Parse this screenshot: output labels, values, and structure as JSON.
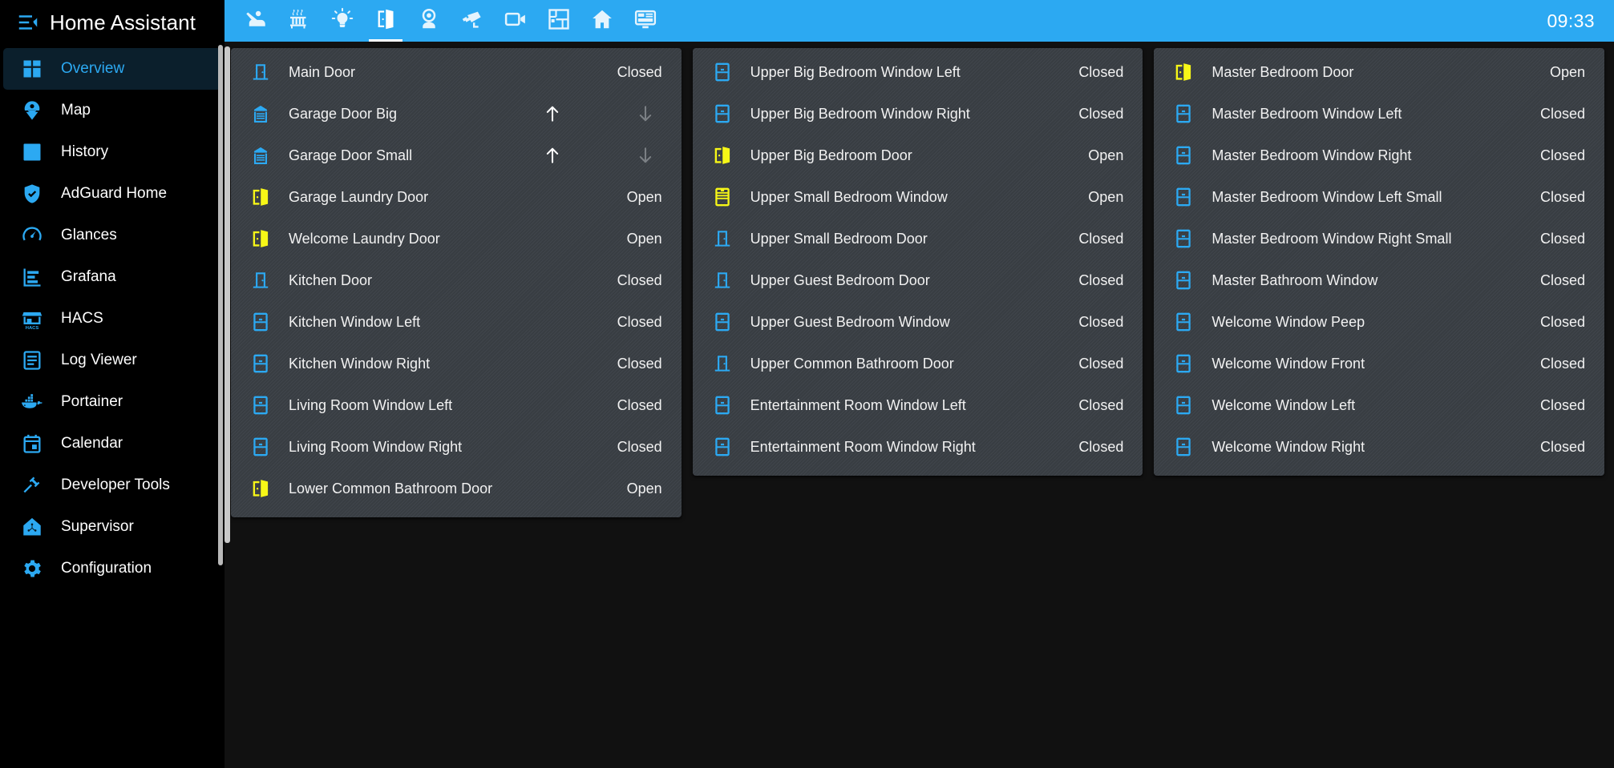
{
  "app": {
    "title": "Home Assistant",
    "accent_color": "#2ca9f2",
    "open_color": "#f7f717",
    "closed_color": "#2ca9f2",
    "menu_icon": "menu-collapse-icon"
  },
  "sidebar": {
    "items": [
      {
        "label": "Overview",
        "icon": "view-dashboard-icon",
        "active": true
      },
      {
        "label": "Map",
        "icon": "map-marker-account-icon",
        "active": false
      },
      {
        "label": "History",
        "icon": "chart-box-icon",
        "active": false
      },
      {
        "label": "AdGuard Home",
        "icon": "shield-check-icon",
        "active": false
      },
      {
        "label": "Glances",
        "icon": "gauge-icon",
        "active": false
      },
      {
        "label": "Grafana",
        "icon": "chart-bar-stacked-icon",
        "active": false
      },
      {
        "label": "HACS",
        "icon": "hacs-store-icon",
        "active": false
      },
      {
        "label": "Log Viewer",
        "icon": "file-document-icon",
        "active": false
      },
      {
        "label": "Portainer",
        "icon": "docker-whale-icon",
        "active": false
      },
      {
        "label": "Calendar",
        "icon": "calendar-icon",
        "active": false
      },
      {
        "label": "Developer Tools",
        "icon": "hammer-icon",
        "active": false
      },
      {
        "label": "Supervisor",
        "icon": "home-assistant-supervisor-icon",
        "active": false
      },
      {
        "label": "Configuration",
        "icon": "cog-icon",
        "active": false
      }
    ]
  },
  "topbar": {
    "clock": "09:33",
    "tabs": [
      {
        "icon": "person-lounging-icon",
        "name": "lounge",
        "active": false
      },
      {
        "icon": "radiator-icon",
        "name": "heating",
        "active": false
      },
      {
        "icon": "lightbulb-icon",
        "name": "lights",
        "active": false
      },
      {
        "icon": "door-open-icon",
        "name": "doors",
        "active": true
      },
      {
        "icon": "webcam-icon",
        "name": "webcam",
        "active": false
      },
      {
        "icon": "cctv-icon",
        "name": "cctv",
        "active": false
      },
      {
        "icon": "video-icon",
        "name": "video",
        "active": false
      },
      {
        "icon": "floor-plan-icon",
        "name": "floorplan",
        "active": false
      },
      {
        "icon": "home-icon",
        "name": "home",
        "active": false
      },
      {
        "icon": "monitor-dashboard-icon",
        "name": "dashboard",
        "active": false
      }
    ]
  },
  "columns": [
    {
      "rows": [
        {
          "icon": "door-closed-icon",
          "name": "Main Door",
          "state": "Closed",
          "type": "state"
        },
        {
          "icon": "garage-icon",
          "name": "Garage Door Big",
          "state": "",
          "type": "cover",
          "up_enabled": true,
          "down_enabled": false
        },
        {
          "icon": "garage-icon",
          "name": "Garage Door Small",
          "state": "",
          "type": "cover",
          "up_enabled": true,
          "down_enabled": false
        },
        {
          "icon": "door-open-icon",
          "name": "Garage Laundry Door",
          "state": "Open",
          "type": "state"
        },
        {
          "icon": "door-open-icon",
          "name": "Welcome Laundry Door",
          "state": "Open",
          "type": "state"
        },
        {
          "icon": "door-closed-icon",
          "name": "Kitchen Door",
          "state": "Closed",
          "type": "state"
        },
        {
          "icon": "window-closed-icon",
          "name": "Kitchen Window Left",
          "state": "Closed",
          "type": "state"
        },
        {
          "icon": "window-closed-icon",
          "name": "Kitchen Window Right",
          "state": "Closed",
          "type": "state"
        },
        {
          "icon": "window-closed-icon",
          "name": "Living Room Window Left",
          "state": "Closed",
          "type": "state"
        },
        {
          "icon": "window-closed-icon",
          "name": "Living Room Window Right",
          "state": "Closed",
          "type": "state"
        },
        {
          "icon": "door-open-icon",
          "name": "Lower Common Bathroom Door",
          "state": "Open",
          "type": "state"
        }
      ]
    },
    {
      "rows": [
        {
          "icon": "window-closed-icon",
          "name": "Upper Big Bedroom Window Left",
          "state": "Closed",
          "type": "state"
        },
        {
          "icon": "window-closed-icon",
          "name": "Upper Big Bedroom Window Right",
          "state": "Closed",
          "type": "state"
        },
        {
          "icon": "door-open-icon",
          "name": "Upper Big Bedroom Door",
          "state": "Open",
          "type": "state"
        },
        {
          "icon": "window-open-icon",
          "name": "Upper Small Bedroom Window",
          "state": "Open",
          "type": "state"
        },
        {
          "icon": "door-closed-icon",
          "name": "Upper Small Bedroom Door",
          "state": "Closed",
          "type": "state"
        },
        {
          "icon": "door-closed-icon",
          "name": "Upper Guest Bedroom Door",
          "state": "Closed",
          "type": "state"
        },
        {
          "icon": "window-closed-icon",
          "name": "Upper Guest Bedroom Window",
          "state": "Closed",
          "type": "state"
        },
        {
          "icon": "door-closed-icon",
          "name": "Upper Common Bathroom Door",
          "state": "Closed",
          "type": "state"
        },
        {
          "icon": "window-closed-icon",
          "name": "Entertainment Room Window Left",
          "state": "Closed",
          "type": "state"
        },
        {
          "icon": "window-closed-icon",
          "name": "Entertainment Room Window Right",
          "state": "Closed",
          "type": "state"
        }
      ]
    },
    {
      "rows": [
        {
          "icon": "door-open-icon",
          "name": "Master Bedroom Door",
          "state": "Open",
          "type": "state"
        },
        {
          "icon": "window-closed-icon",
          "name": "Master Bedroom Window Left",
          "state": "Closed",
          "type": "state"
        },
        {
          "icon": "window-closed-icon",
          "name": "Master Bedroom Window Right",
          "state": "Closed",
          "type": "state"
        },
        {
          "icon": "window-closed-icon",
          "name": "Master Bedroom Window Left Small",
          "state": "Closed",
          "type": "state"
        },
        {
          "icon": "window-closed-icon",
          "name": "Master Bedroom Window Right Small",
          "state": "Closed",
          "type": "state"
        },
        {
          "icon": "window-closed-icon",
          "name": "Master Bathroom Window",
          "state": "Closed",
          "type": "state"
        },
        {
          "icon": "window-closed-icon",
          "name": "Welcome Window Peep",
          "state": "Closed",
          "type": "state"
        },
        {
          "icon": "window-closed-icon",
          "name": "Welcome Window Front",
          "state": "Closed",
          "type": "state"
        },
        {
          "icon": "window-closed-icon",
          "name": "Welcome Window Left",
          "state": "Closed",
          "type": "state"
        },
        {
          "icon": "window-closed-icon",
          "name": "Welcome Window Right",
          "state": "Closed",
          "type": "state"
        }
      ]
    }
  ]
}
